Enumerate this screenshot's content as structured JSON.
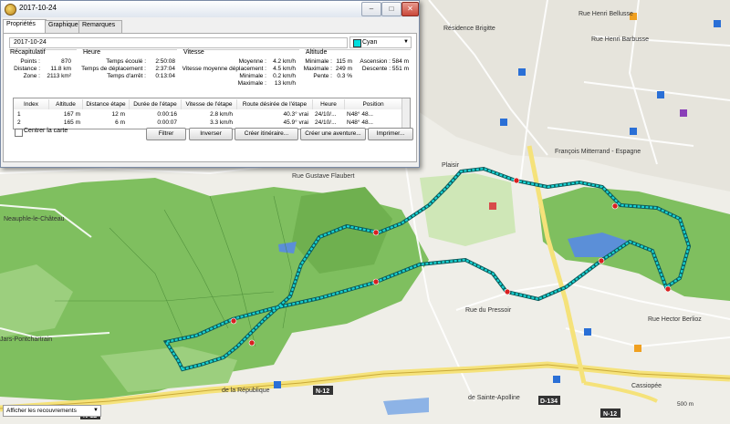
{
  "window": {
    "title": "2017-10-24",
    "min_label": "–",
    "max_label": "□",
    "close_label": "✕",
    "tabs": [
      "Propriétés",
      "Graphique",
      "Remarques"
    ]
  },
  "track": {
    "name": "2017-10-24",
    "color_name": "Cyan",
    "color_hex": "#00dede"
  },
  "summary": {
    "title": "Récapitulatif",
    "points_label": "Points :",
    "points": "870",
    "distance_label": "Distance :",
    "distance": "11.8 km",
    "zone_label": "Zone :",
    "zone": "2113 km²"
  },
  "time": {
    "title": "Heure",
    "elapsed_label": "Temps écoulé :",
    "elapsed": "2:50:08",
    "moving_label": "Temps de déplacement :",
    "moving": "2:37:04",
    "stopped_label": "Temps d'arrêt :",
    "stopped": "0:13:04"
  },
  "speed": {
    "title": "Vitesse",
    "avg_label": "Moyenne :",
    "avg": "4.2 km/h",
    "moving_avg_label": "Vitesse moyenne déplacement :",
    "moving_avg": "4.5 km/h",
    "min_label": "Minimale :",
    "min": "0.2 km/h",
    "max_label": "Maximale :",
    "max": "13 km/h"
  },
  "altitude": {
    "title": "Altitude",
    "min_label": "Minimale :",
    "min": "115 m",
    "max_label": "Maximale :",
    "max": "249 m",
    "slope_label": "Pente :",
    "slope": "0.3 %",
    "ascent_label": "Ascension :",
    "ascent": "584 m",
    "descent_label": "Descente :",
    "descent": "551 m"
  },
  "table": {
    "headers": [
      "Index",
      "Altitude",
      "Distance étape",
      "Durée de l'étape",
      "Vitesse de l'étape",
      "Route désirée de l'étape",
      "Heure",
      "Position"
    ],
    "rows": [
      [
        "1",
        "167 m",
        "12 m",
        "0:00:16",
        "2.8 km/h",
        "40.3° vrai",
        "24/10/...",
        "N48° 48..."
      ],
      [
        "2",
        "165 m",
        "6 m",
        "0:00:07",
        "3.3 km/h",
        "45.9° vrai",
        "24/10/...",
        "N48° 48..."
      ]
    ]
  },
  "controls": {
    "center_map": "Centrer la carte",
    "filter": "Filtrer",
    "invert": "Inverser",
    "create_route": "Créer itinéraire...",
    "create_adventure": "Créer une aventure...",
    "print": "Imprimer..."
  },
  "map": {
    "overlap_select": "Afficher les recouvrements",
    "scale": "500 m",
    "labels": {
      "residence": "Résidence Brigitte",
      "rue_bellusse": "Rue Henri Bellusse",
      "rue_barbusse": "Rue Henri Barbusse",
      "plaisir": "Plaisir",
      "neauphle": "Neauphle-le-Château",
      "pontchartrain": "Jars-Pontchartrain",
      "rue_pressoir": "Rue du Pressoir",
      "rue_berlioz": "Rue Hector Berlioz",
      "rue_republique": "de la République",
      "rue_flaubert": "Rue Gustave Flaubert",
      "rue_mitterrand": "François Mitterrand - Espagne",
      "n12": "N-12",
      "d134": "D-134",
      "sainte_apolline": "de Sainte-Apolline",
      "cassiopee": "Cassiopée"
    }
  }
}
